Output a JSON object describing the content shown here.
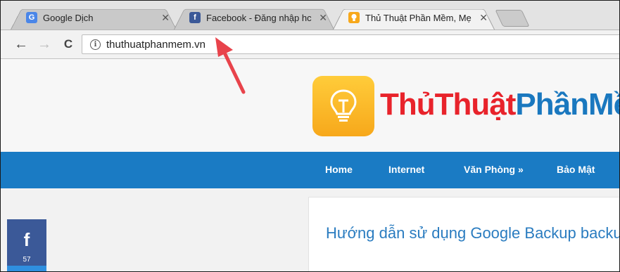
{
  "browser": {
    "tabs": [
      {
        "title": "Google Dịch",
        "favicon": "google-translate-icon",
        "color": "#4a86e8"
      },
      {
        "title": "Facebook - Đăng nhập hc",
        "favicon": "facebook-icon",
        "color": "#3b5998"
      },
      {
        "title": "Thủ Thuật Phần Mềm, Mẹ",
        "favicon": "lightbulb-icon",
        "color": "#f7a81b",
        "active": true
      }
    ],
    "close_glyph": "✕",
    "toolbar": {
      "back": "←",
      "forward": "→",
      "reload": "C",
      "info": "i",
      "url": "thuthuatphanmem.vn"
    }
  },
  "page": {
    "logo": {
      "part1": "Thủ",
      "part2": "Thuật",
      "part3": "Phần",
      "part4": "Mềm"
    },
    "nav": [
      "Home",
      "Internet",
      "Văn Phòng »",
      "Bảo Mật"
    ],
    "article": {
      "title": "Hướng dẫn sử dụng Google Backup backup dữ liệu"
    },
    "share": {
      "icon": "facebook-icon",
      "glyph": "f",
      "count": "57"
    }
  },
  "colors": {
    "brand_red": "#e8232b",
    "brand_blue": "#1a78bf",
    "nav_bg": "#1a7bc4",
    "annotation_arrow": "#e8434b"
  }
}
